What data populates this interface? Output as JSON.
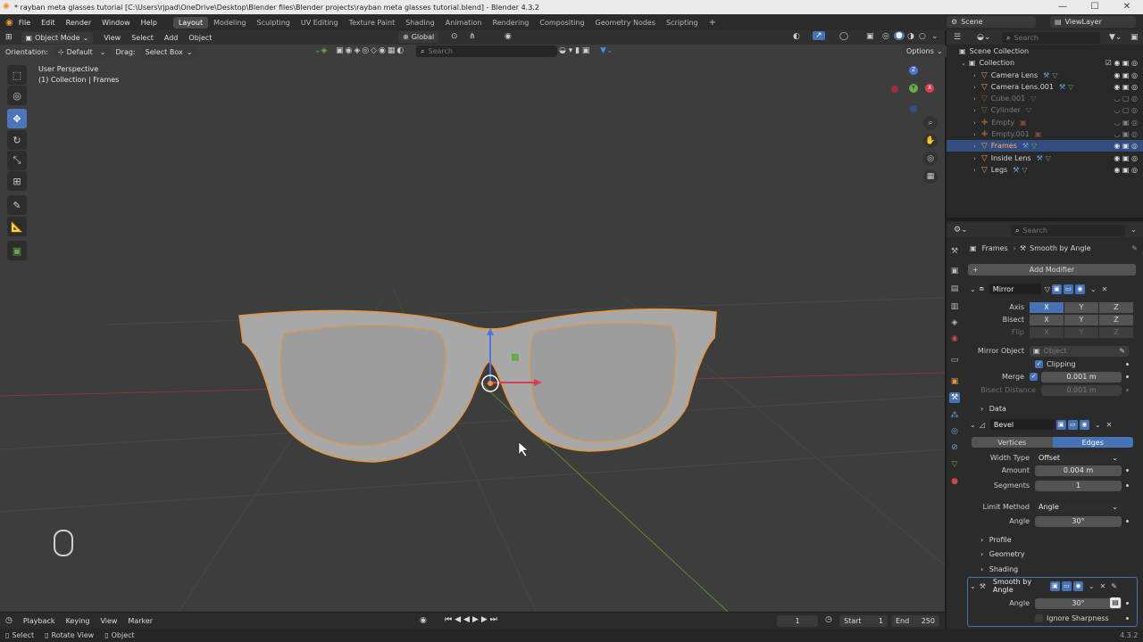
{
  "window": {
    "title": "* rayban meta glasses tutorial [C:\\Users\\rjpad\\OneDrive\\Desktop\\Blender files\\Blender projects\\rayban meta glasses tutorial.blend] - Blender 4.3.2",
    "minimize": "—",
    "maximize": "☐",
    "close": "✕"
  },
  "menu": [
    "File",
    "Edit",
    "Render",
    "Window",
    "Help"
  ],
  "workspaces": [
    "Layout",
    "Modeling",
    "Sculpting",
    "UV Editing",
    "Texture Paint",
    "Shading",
    "Animation",
    "Rendering",
    "Compositing",
    "Geometry Nodes",
    "Scripting"
  ],
  "active_workspace": "Layout",
  "scene": {
    "label": "Scene",
    "view_layer": "ViewLayer"
  },
  "viewport_header": {
    "mode": "Object Mode",
    "menus": [
      "View",
      "Select",
      "Add",
      "Object"
    ],
    "transform": "Global",
    "orientation_label": "Orientation:",
    "orientation_value": "Default",
    "drag_label": "Drag:",
    "drag_value": "Select Box",
    "search_placeholder": "Search",
    "options": "Options"
  },
  "viewport": {
    "perspective": "User Perspective",
    "collection_info": "(1) Collection | Frames"
  },
  "axes": {
    "x": "X",
    "y": "Y",
    "z": "Z"
  },
  "outliner": {
    "search_placeholder": "Search",
    "root": "Scene Collection",
    "collection": "Collection",
    "items": [
      {
        "name": "Camera Lens",
        "selected": false,
        "dim": false
      },
      {
        "name": "Camera Lens.001",
        "selected": false,
        "dim": false
      },
      {
        "name": "Cube.001",
        "selected": false,
        "dim": true
      },
      {
        "name": "Cylinder",
        "selected": false,
        "dim": true
      },
      {
        "name": "Empty",
        "selected": false,
        "dim": true
      },
      {
        "name": "Empty.001",
        "selected": false,
        "dim": true
      },
      {
        "name": "Frames",
        "selected": true,
        "dim": false
      },
      {
        "name": "Inside Lens",
        "selected": false,
        "dim": false
      },
      {
        "name": "Legs",
        "selected": false,
        "dim": false
      }
    ]
  },
  "properties": {
    "search_placeholder": "Search",
    "breadcrumb_object": "Frames",
    "breadcrumb_modifier": "Smooth by Angle",
    "add_modifier": "Add Modifier",
    "mirror": {
      "name": "Mirror",
      "axis_label": "Axis",
      "bisect_label": "Bisect",
      "flip_label": "Flip",
      "x": "X",
      "y": "Y",
      "z": "Z",
      "mirror_object_label": "Mirror Object",
      "mirror_object_placeholder": "Object",
      "clipping_label": "Clipping",
      "merge_label": "Merge",
      "merge_value": "0.001 m",
      "bisect_distance_label": "Bisect Distance",
      "bisect_distance_value": "0.001 m",
      "data_label": "Data"
    },
    "bevel": {
      "name": "Bevel",
      "tab_vertices": "Vertices",
      "tab_edges": "Edges",
      "width_type_label": "Width Type",
      "width_type_value": "Offset",
      "amount_label": "Amount",
      "amount_value": "0.004 m",
      "segments_label": "Segments",
      "segments_value": "1",
      "limit_method_label": "Limit Method",
      "limit_method_value": "Angle",
      "angle_label": "Angle",
      "angle_value": "30°",
      "profile_label": "Profile",
      "geometry_label": "Geometry",
      "shading_label": "Shading"
    },
    "smooth": {
      "name": "Smooth by Angle",
      "angle_label": "Angle",
      "angle_value": "30°",
      "ignore_sharpness_label": "Ignore Sharpness"
    }
  },
  "timeline": {
    "menus": [
      "Playback",
      "Keying",
      "View",
      "Marker"
    ],
    "current_frame": "1",
    "start_label": "Start",
    "start_value": "1",
    "end_label": "End",
    "end_value": "250"
  },
  "statusbar": {
    "items": [
      "Select",
      "Rotate View",
      "Object"
    ],
    "version": "4.3.2"
  }
}
